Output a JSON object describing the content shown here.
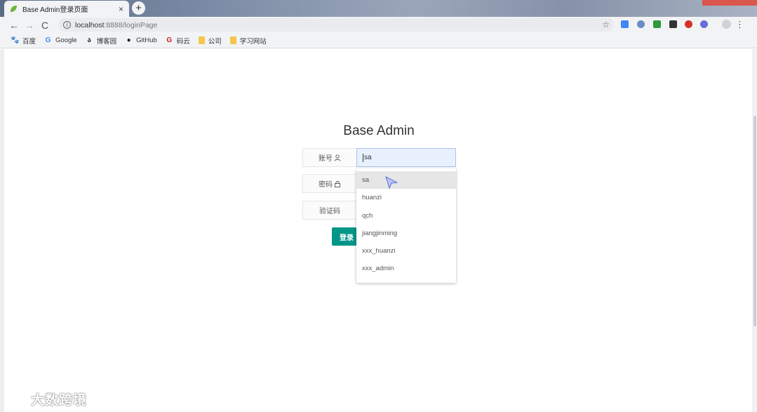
{
  "browser": {
    "tab_title": "Base Admin登录页面",
    "tab_close": "×",
    "new_tab": "+",
    "url_host": "localhost",
    "url_path": ":8888/loginPage",
    "star": "☆",
    "menu": "⋮"
  },
  "bookmarks": [
    {
      "label": "百度",
      "icon": "paw-icon",
      "glyph": "🐾",
      "color": "#3b6cd9"
    },
    {
      "label": "Google",
      "icon": "google-icon",
      "glyph": "G",
      "color": "#4285f4"
    },
    {
      "label": "博客园",
      "icon": "cnblogs-icon",
      "glyph": "ა",
      "color": "#333333"
    },
    {
      "label": "GitHub",
      "icon": "github-icon",
      "glyph": "●",
      "color": "#222222"
    },
    {
      "label": "码云",
      "icon": "gitee-icon",
      "glyph": "G",
      "color": "#c71d23"
    },
    {
      "label": "公司",
      "icon": "folder-icon",
      "glyph": "",
      "color": "#f5c74a"
    },
    {
      "label": "学习网站",
      "icon": "folder-icon",
      "glyph": "",
      "color": "#f5c74a"
    }
  ],
  "login": {
    "title": "Base Admin",
    "account_label": "账号",
    "account_icon": "user-icon",
    "account_value": "sa",
    "password_label": "密码",
    "password_icon": "lock-icon",
    "captcha_label": "验证码",
    "login_button": "登录"
  },
  "autocomplete": [
    "sa",
    "huanzi",
    "qch",
    "jiangjinming",
    "xxx_huanzi",
    "xxx_admin"
  ],
  "watermark": "大数跨境",
  "colors": {
    "primary_button": "#009688",
    "input_autofill": "#e8f0fe"
  }
}
